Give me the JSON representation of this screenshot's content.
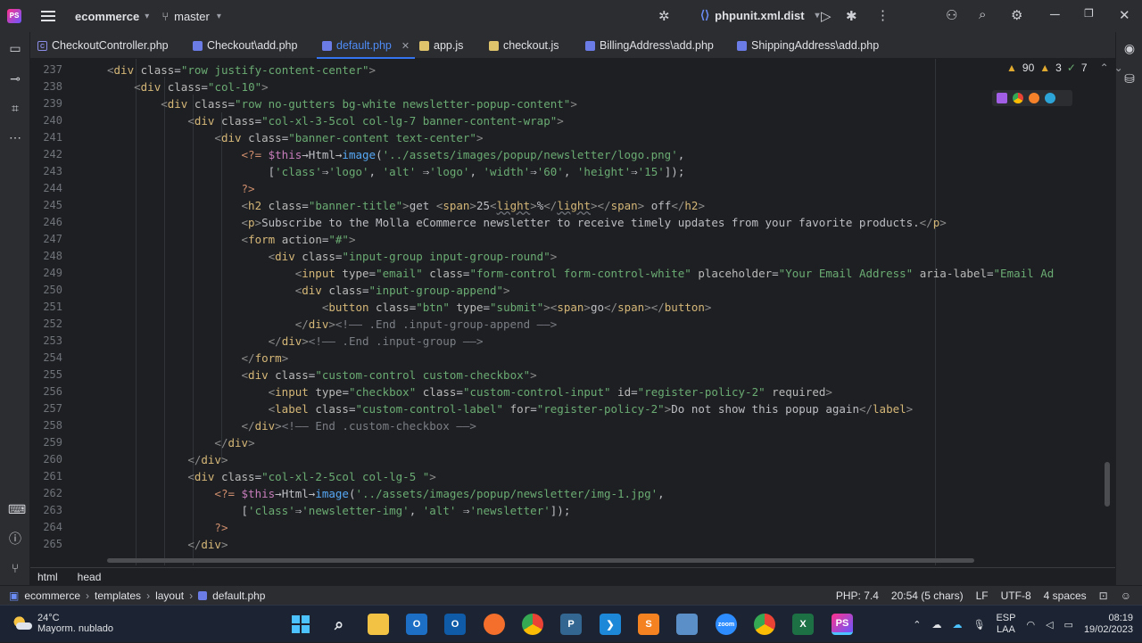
{
  "titlebar": {
    "project": "ecommerce",
    "branch": "master",
    "run_config": "phpunit.xml.dist"
  },
  "tabs": [
    {
      "label": "CheckoutController.php",
      "icon": "fi-c"
    },
    {
      "label": "Checkout\\add.php",
      "icon": "fi-php"
    },
    {
      "label": "default.php",
      "icon": "fi-php",
      "active": true
    },
    {
      "label": "app.js",
      "icon": "fi-js"
    },
    {
      "label": "checkout.js",
      "icon": "fi-js"
    },
    {
      "label": "BillingAddress\\add.php",
      "icon": "fi-php"
    },
    {
      "label": "ShippingAddress\\add.php",
      "icon": "fi-php"
    }
  ],
  "inspections": {
    "warnings": "90",
    "weak": "3",
    "typos": "7"
  },
  "line_numbers": [
    "237",
    "238",
    "239",
    "240",
    "241",
    "242",
    "243",
    "244",
    "245",
    "246",
    "247",
    "248",
    "249",
    "250",
    "251",
    "252",
    "253",
    "254",
    "255",
    "256",
    "257",
    "258",
    "259",
    "260",
    "261",
    "262",
    "263",
    "264",
    "265"
  ],
  "breadcrumb": {
    "items": [
      "html",
      "head"
    ]
  },
  "statusbar": {
    "path": [
      "ecommerce",
      "templates",
      "layout",
      "default.php"
    ],
    "php": "PHP: 7.4",
    "position": "20:54 (5 chars)",
    "line_sep": "LF",
    "encoding": "UTF-8",
    "indent": "4 spaces"
  },
  "taskbar": {
    "temperature": "24°C",
    "weather": "Mayorm. nublado",
    "lang": "ESP",
    "lang2": "LAA",
    "time": "08:19",
    "date": "19/02/2023"
  },
  "colors": {
    "accent": "#3574f0",
    "tag": "#d5b778",
    "string": "#6aab73",
    "warning": "#e0a930"
  }
}
